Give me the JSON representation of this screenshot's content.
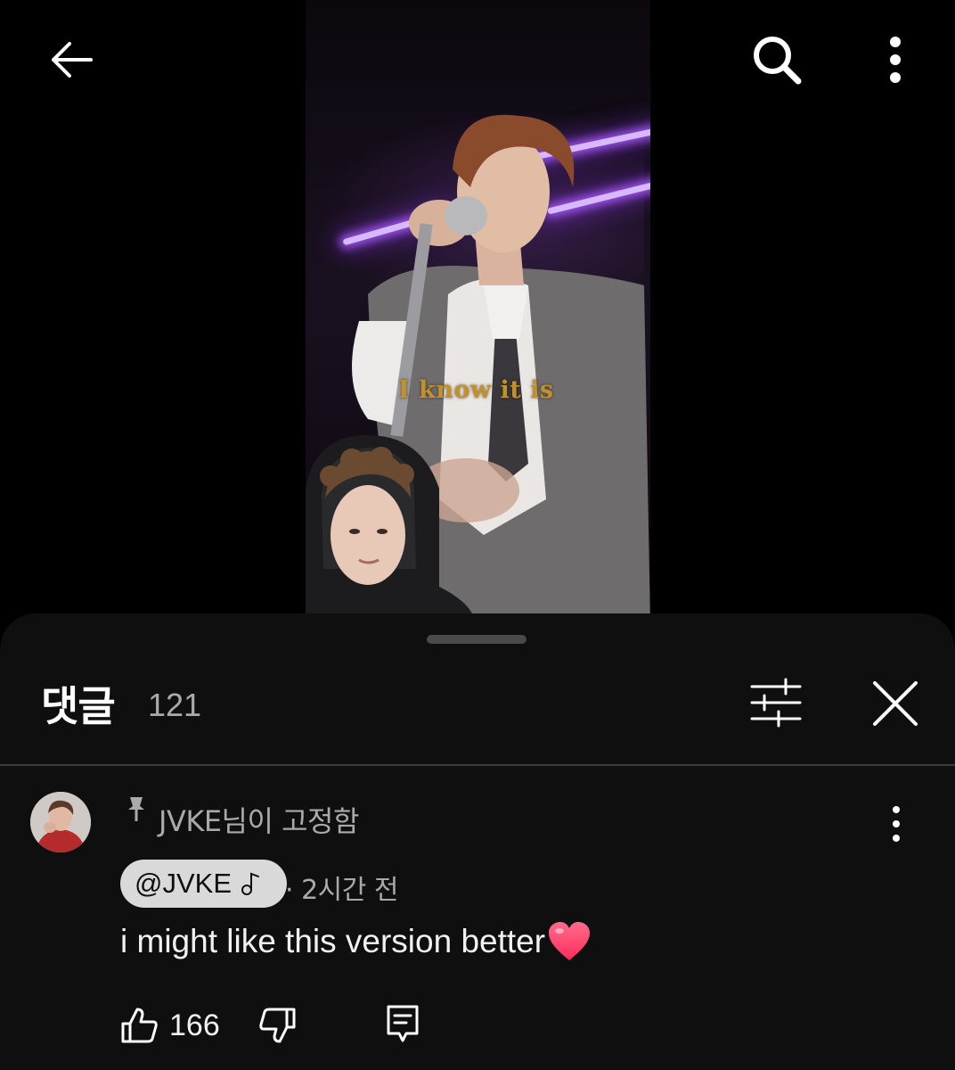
{
  "video": {
    "caption": "I know it is"
  },
  "comments_sheet": {
    "title": "댓글",
    "count": "121"
  },
  "pinned_comment": {
    "pinned_label": "JVKE님이 고정함",
    "author": "@JVKE",
    "timestamp": "· 2시간 전",
    "text": "i might like this version better",
    "likes": "166"
  },
  "icons": {
    "back": "arrow-left-icon",
    "search": "search-icon",
    "more": "more-vertical-icon",
    "filter": "sliders-icon",
    "close": "close-icon",
    "pin": "pin-icon",
    "note": "music-note-icon",
    "heart": "heart-emoji-icon",
    "like": "thumbs-up-icon",
    "dislike": "thumbs-down-icon",
    "reply": "reply-icon"
  },
  "colors": {
    "background": "#000000",
    "sheet": "#0f0f0f",
    "secondary_text": "#aaaaaa",
    "chip": "#d9d9d9",
    "caption": "#c2912c",
    "heart": "#ff3b6b"
  }
}
